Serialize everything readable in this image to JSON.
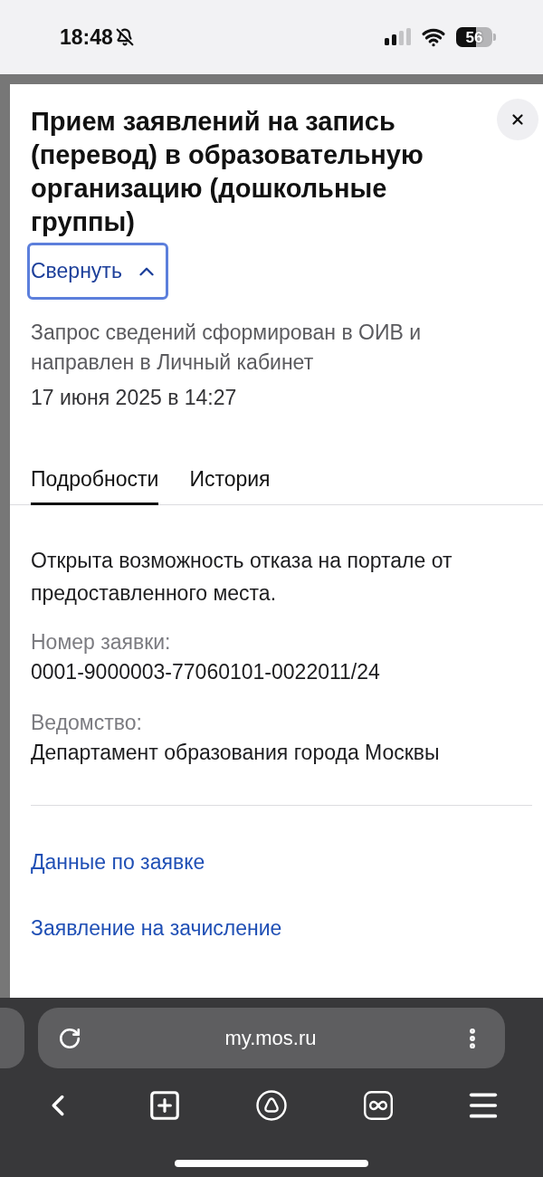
{
  "status_bar": {
    "time": "18:48",
    "battery": "56"
  },
  "sheet": {
    "title": "Прием заявлений на запись (перевод) в образовательную организацию (дошкольные группы)",
    "collapse_button": {
      "label": "Свернуть",
      "expanded": true,
      "focused": true
    },
    "status": {
      "message": "Запрос сведений сформирован в ОИВ и направлен в Личный кабинет",
      "date": "17 июня 2025 в 14:27"
    },
    "tabs": [
      {
        "label": "Подробности",
        "selected": true
      },
      {
        "label": "История",
        "selected": false
      }
    ],
    "details": {
      "note": "Открыта возможность отказа на портале от предоставленного места.",
      "fields": [
        {
          "label": "Номер заявки:",
          "value": "0001-9000003-77060101-0022011/24"
        },
        {
          "label": "Ведомство:",
          "value": "Департамент образования города Москвы"
        }
      ]
    },
    "links": [
      "Данные по заявке",
      "Заявление на зачисление"
    ]
  },
  "browser": {
    "url": "my.mos.ru"
  }
}
